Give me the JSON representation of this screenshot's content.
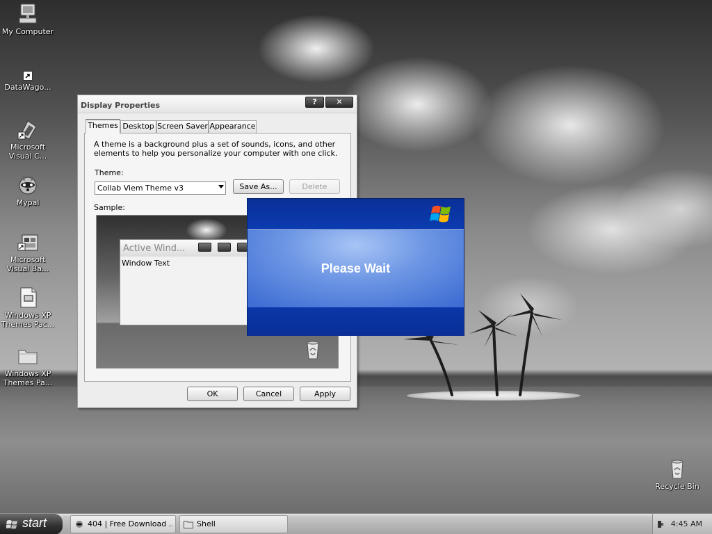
{
  "desktop": {
    "icons": [
      {
        "label": "My Computer",
        "icon": "my-computer-icon"
      },
      {
        "label": "DataWago...",
        "icon": "shortcut-icon"
      },
      {
        "label": "Microsoft Visual C...",
        "icon": "visual-c-icon"
      },
      {
        "label": "Mypal",
        "icon": "mypal-raccoon-icon"
      },
      {
        "label": "Microsoft Visual Ba...",
        "icon": "visual-basic-icon"
      },
      {
        "label": "Windows XP Themes Pac...",
        "icon": "installer-file-icon"
      },
      {
        "label": "Windows XP Themes Pa...",
        "icon": "folder-icon"
      },
      {
        "label": "Recycle Bin",
        "icon": "recycle-bin-icon"
      }
    ]
  },
  "dialog": {
    "title": "Display Properties",
    "help_label": "?",
    "close_label": "✕",
    "tabs": [
      {
        "label": "Themes",
        "active": true
      },
      {
        "label": "Desktop",
        "active": false
      },
      {
        "label": "Screen Saver",
        "active": false
      },
      {
        "label": "Appearance",
        "active": false
      }
    ],
    "description": "A theme is a background plus a set of sounds, icons, and other elements to help you personalize your computer with one click.",
    "theme_label": "Theme:",
    "theme_value": "Collab Viem Theme v3",
    "save_as_label": "Save As...",
    "delete_label": "Delete",
    "sample_label": "Sample:",
    "sample_window_title": "Active Wind...",
    "sample_window_text": "Window Text",
    "ok_label": "OK",
    "cancel_label": "Cancel",
    "apply_label": "Apply"
  },
  "splash": {
    "message": "Please Wait",
    "logo": "windows-xp-flag-icon",
    "colors": {
      "frame": "#0a34a0",
      "center": "#6e97e4"
    }
  },
  "taskbar": {
    "start_label": "start",
    "tasks": [
      {
        "label": "404 | Free Download ...",
        "icon": "mypal-raccoon-icon"
      },
      {
        "label": "Shell",
        "icon": "folder-icon"
      }
    ],
    "clock": "4:45 AM"
  }
}
